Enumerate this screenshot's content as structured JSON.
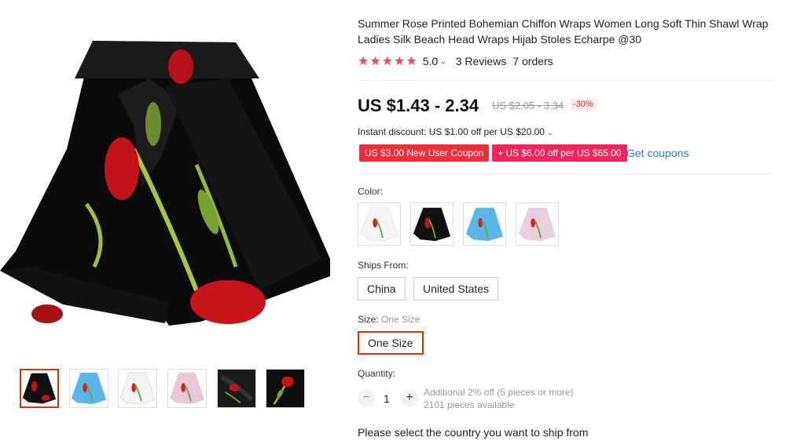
{
  "product": {
    "title": "Summer Rose Printed Bohemian Chiffon Wraps Women Long Soft Thin Shawl Wrap Ladies Silk Beach Head Wraps Hijab Stoles Echarpe @30",
    "rating": "5.0",
    "reviews": "3 Reviews",
    "orders": "7 orders"
  },
  "price": {
    "current": "US $1.43 - 2.34",
    "original": "US $2.05 - 3.34",
    "discount": "-30%"
  },
  "promo": {
    "instant_discount": "Instant discount: US $1.00 off per US $20.00",
    "coupon_new_user": "US $3.00 New User Coupon",
    "coupon_store": "+ US $6.00 off per US $65.00",
    "get_coupons": "Get coupons"
  },
  "color": {
    "label": "Color:",
    "options": [
      "white",
      "black",
      "blue",
      "pink"
    ]
  },
  "ships_from": {
    "label": "Ships From:",
    "options": [
      "China",
      "United States"
    ]
  },
  "size": {
    "label": "Size:",
    "selected": "One Size",
    "options": [
      "One Size"
    ]
  },
  "quantity": {
    "label": "Quantity:",
    "value": "1",
    "minus": "−",
    "plus": "+",
    "discount_note": "Additional 2% off (5 pieces or more)",
    "available": "2101 pieces available"
  },
  "shipping_message": "Please select the country you want to ship from",
  "colors": {
    "accent": "#e62e04",
    "star": "#f04a57",
    "coupon_red": "#f02e3a",
    "link_blue": "#2e7cc2"
  }
}
